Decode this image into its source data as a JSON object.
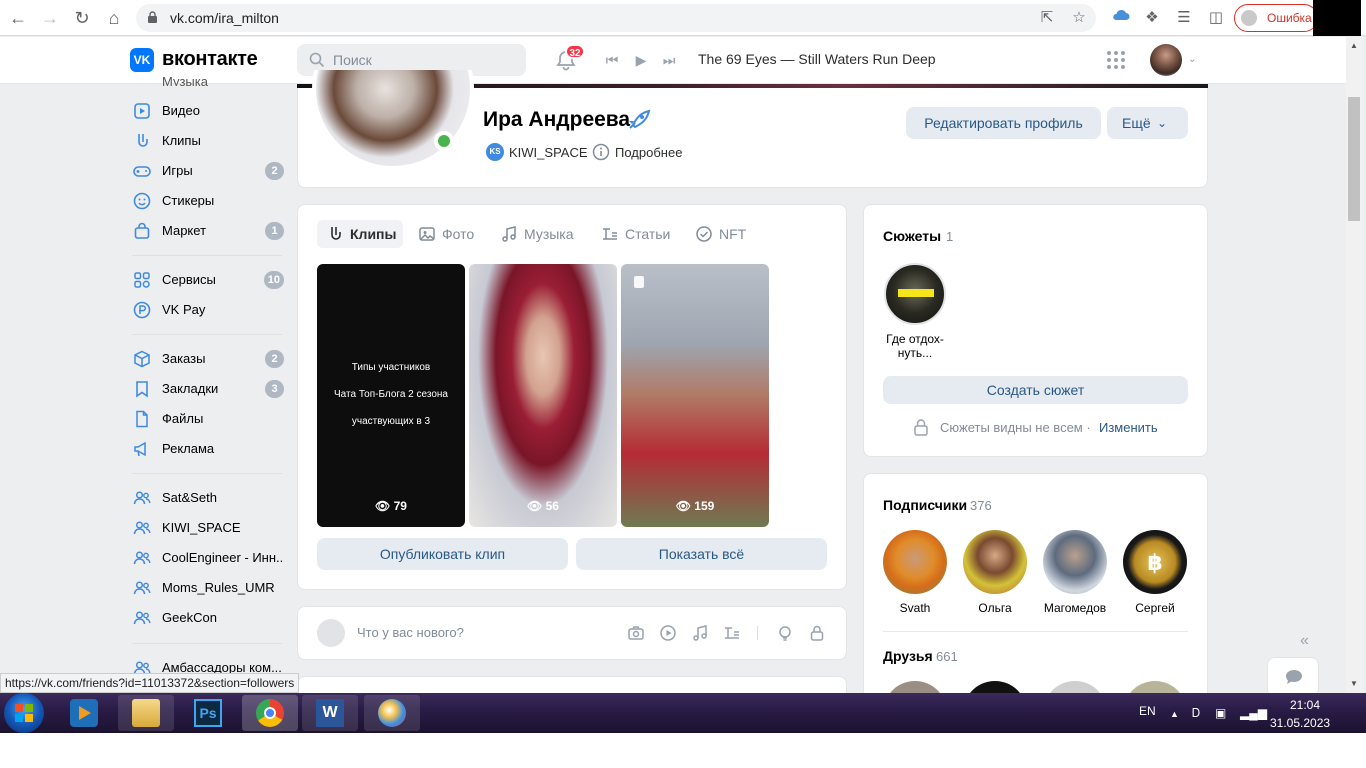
{
  "browser": {
    "url": "vk.com/ira_milton",
    "error_label": "Ошибка"
  },
  "header": {
    "logo_text": "вконтакте",
    "search_placeholder": "Поиск",
    "notifications_count": "32",
    "now_playing": "The 69 Eyes — Still Waters Run Deep"
  },
  "sidebar": {
    "top_cut_label": "Музыка",
    "items": [
      {
        "label": "Видео",
        "icon": "video-icon"
      },
      {
        "label": "Клипы",
        "icon": "clips-icon"
      },
      {
        "label": "Игры",
        "icon": "gamepad-icon",
        "badge": "2"
      },
      {
        "label": "Стикеры",
        "icon": "smile-icon"
      },
      {
        "label": "Маркет",
        "icon": "bag-icon",
        "badge": "1"
      },
      {
        "label": "Сервисы",
        "icon": "apps-icon",
        "badge": "10"
      },
      {
        "label": "VK Pay",
        "icon": "pay-icon"
      },
      {
        "label": "Заказы",
        "icon": "box-icon",
        "badge": "2"
      },
      {
        "label": "Закладки",
        "icon": "bookmark-icon",
        "badge": "3"
      },
      {
        "label": "Файлы",
        "icon": "file-icon"
      },
      {
        "label": "Реклама",
        "icon": "megaphone-icon"
      },
      {
        "label": "Sat&Seth",
        "icon": "group-icon"
      },
      {
        "label": "KIWI_SPACE",
        "icon": "group-icon"
      },
      {
        "label": "CoolEngineer - Инн...",
        "icon": "group-icon"
      },
      {
        "label": "Moms_Rules_UMR",
        "icon": "group-icon"
      },
      {
        "label": "GeekCon",
        "icon": "group-icon"
      },
      {
        "label": "Амбассадоры ком...",
        "icon": "group-icon"
      }
    ]
  },
  "profile": {
    "name": "Ира Андреева",
    "group_link": "KIWI_SPACE",
    "details_link": "Подробнее",
    "edit_button": "Редактировать профиль",
    "more_button": "Ещё"
  },
  "media": {
    "tabs": [
      "Клипы",
      "Фото",
      "Музыка",
      "Статьи",
      "NFT"
    ],
    "clips": [
      {
        "views": "79",
        "text_lines": [
          "Типы участников",
          "Чата Топ-Блога 2 сезона",
          "участвующих в 3"
        ]
      },
      {
        "views": "56"
      },
      {
        "views": "159"
      }
    ],
    "publish_button": "Опубликовать клип",
    "show_all_button": "Показать всё"
  },
  "composer": {
    "placeholder": "Что у вас нового?"
  },
  "stories": {
    "title": "Сюжеты",
    "count": "1",
    "story_caption": "Где отдох-нуть...",
    "create_button": "Создать сюжет",
    "privacy_text": "Сюжеты видны не всем ·",
    "change_link": "Изменить"
  },
  "subscribers": {
    "title": "Подписчики",
    "count": "376",
    "people": [
      "Svath",
      "Ольга",
      "Магомедов",
      "Сергей"
    ]
  },
  "friends": {
    "title": "Друзья",
    "count": "661"
  },
  "status_url": "https://vk.com/friends?id=11013372&section=followers",
  "taskbar": {
    "lang": "EN",
    "time": "21:04",
    "date": "31.05.2023"
  },
  "colors": {
    "vk_blue": "#0077ff",
    "link": "#2a5885",
    "button_bg": "#e5ebf1",
    "online": "#4bb34b",
    "badge": "#ff3347"
  }
}
